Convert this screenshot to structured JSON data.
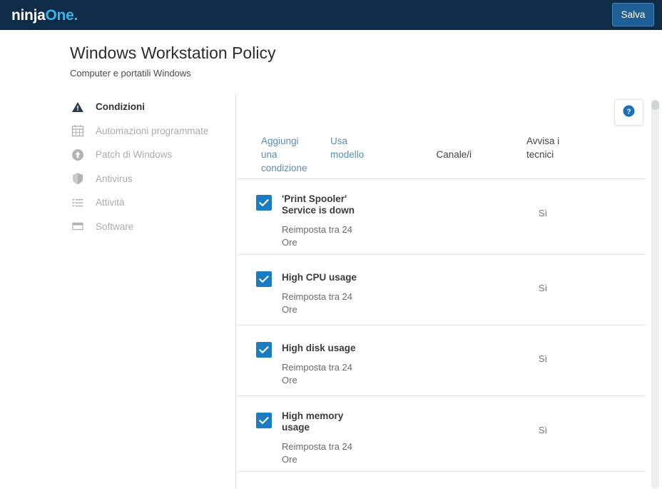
{
  "topbar": {
    "logo_primary": "ninja",
    "logo_secondary": "One",
    "logo_dot": ".",
    "save_label": "Salva",
    "background_color": "#0e2c47",
    "accent_color": "#35b6e8"
  },
  "page": {
    "title": "Windows Workstation Policy",
    "subtitle": "Computer e portatili Windows"
  },
  "sidebar": {
    "items": [
      {
        "label": "Condizioni",
        "icon": "warning-triangle-icon",
        "active": true
      },
      {
        "label": "Automazioni programmate",
        "icon": "calendar-icon",
        "active": false
      },
      {
        "label": "Patch di Windows",
        "icon": "arrow-up-circle-icon",
        "active": false
      },
      {
        "label": "Antivirus",
        "icon": "shield-icon",
        "active": false
      },
      {
        "label": "Attività",
        "icon": "list-icon",
        "active": false
      },
      {
        "label": "Software",
        "icon": "window-icon",
        "active": false
      }
    ]
  },
  "help": {
    "icon": "question-mark-circle-icon",
    "color": "#1b6fb5"
  },
  "table": {
    "header": {
      "add_condition": "Aggiungi una condizione",
      "use_template": "Usa modello",
      "channels": "Canale/i",
      "notify_technicians": "Avvisa i tecnici"
    },
    "rows": [
      {
        "checked": true,
        "title": "'Print Spooler' Service is down",
        "subtitle": "Reimposta tra 24 Ore",
        "channels": "",
        "notify": "Sì"
      },
      {
        "checked": true,
        "title": "High CPU usage",
        "subtitle": "Reimposta tra 24 Ore",
        "channels": "",
        "notify": "Sì"
      },
      {
        "checked": true,
        "title": "High disk usage",
        "subtitle": "Reimposta tra 24 Ore",
        "channels": "",
        "notify": "Sì"
      },
      {
        "checked": true,
        "title": "High memory usage",
        "subtitle": "Reimposta tra 24 Ore",
        "channels": "",
        "notify": "Sì"
      }
    ]
  }
}
